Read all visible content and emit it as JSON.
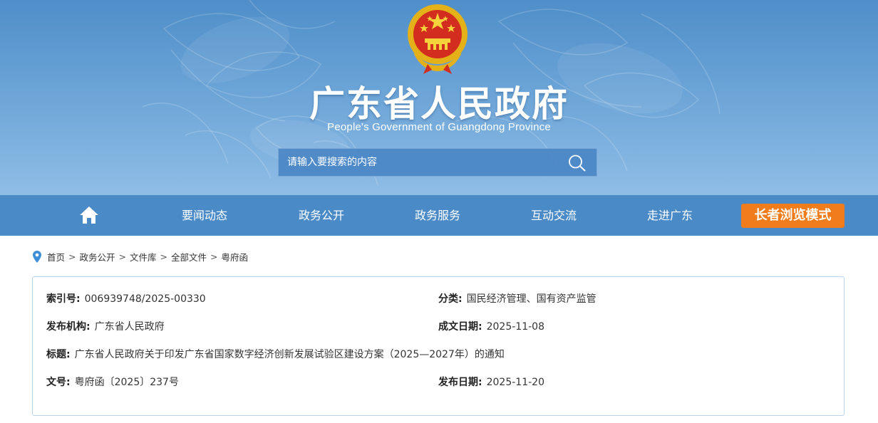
{
  "header": {
    "title": "广东省人民政府",
    "subtitle": "People's Government of Guangdong Province",
    "emblem_icon": "national-emblem-icon"
  },
  "search": {
    "placeholder": "请输入要搜索的内容",
    "icon": "search-icon"
  },
  "nav": {
    "home_icon": "home-icon",
    "items": [
      "要闻动态",
      "政务公开",
      "政务服务",
      "互动交流",
      "走进广东"
    ],
    "elder_mode": "长者浏览模式"
  },
  "breadcrumb": {
    "icon": "location-pin-icon",
    "separator": ">",
    "items": [
      "首页",
      "政务公开",
      "文件库",
      "全部文件",
      "粤府函"
    ]
  },
  "document": {
    "index_label": "索引号:",
    "index_value": "006939748/2025-00330",
    "category_label": "分类:",
    "category_value": "国民经济管理、国有资产监管",
    "publisher_label": "发布机构:",
    "publisher_value": "广东省人民政府",
    "written_date_label": "成文日期:",
    "written_date_value": "2025-11-08",
    "title_label": "标题:",
    "title_value": "广东省人民政府关于印发广东省国家数字经济创新发展试验区建设方案（2025—2027年）的通知",
    "doc_no_label": "文号:",
    "doc_no_value": "粤府函〔2025〕237号",
    "publish_date_label": "发布日期:",
    "publish_date_value": "2025-11-20"
  },
  "colors": {
    "banner_top": "#4f8ec9",
    "nav_bg": "#4a8ac6",
    "elder_button": "#f07c1c",
    "box_border": "#b9d3ea",
    "pin": "#3f8fd8"
  }
}
